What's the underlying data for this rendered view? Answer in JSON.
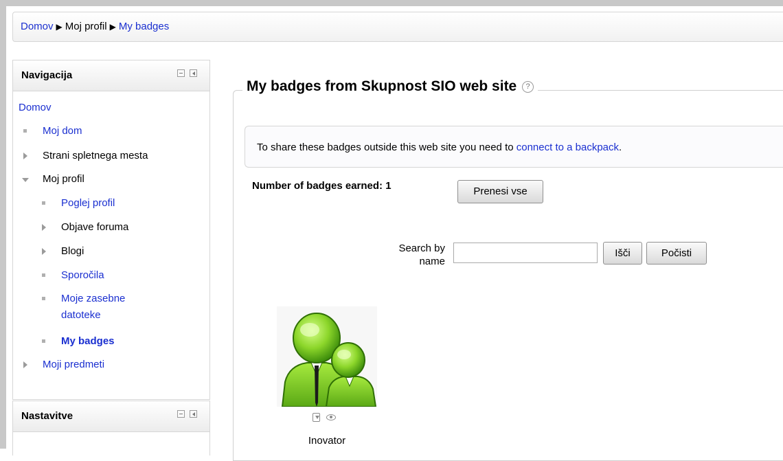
{
  "breadcrumb": {
    "items": [
      "Domov",
      "Moj profil",
      "My badges"
    ],
    "separator": "▶"
  },
  "navigation_block": {
    "title": "Navigacija",
    "items": [
      {
        "label": "Domov",
        "type": "link"
      },
      {
        "label": "Moj dom",
        "type": "link"
      },
      {
        "label": "Strani spletnega mesta",
        "type": "collapsed"
      },
      {
        "label": "Moj profil",
        "type": "expanded"
      },
      {
        "label": "Poglej profil",
        "type": "link"
      },
      {
        "label": "Objave foruma",
        "type": "collapsed"
      },
      {
        "label": "Blogi",
        "type": "collapsed"
      },
      {
        "label": "Sporočila",
        "type": "link"
      },
      {
        "label": "Moje zasebne",
        "type": "link"
      },
      {
        "label": "datoteke",
        "type": "link"
      },
      {
        "label": "My badges",
        "type": "current"
      },
      {
        "label": "Moji predmeti",
        "type": "collapsed"
      }
    ]
  },
  "settings_block": {
    "title": "Nastavitve"
  },
  "main": {
    "heading": "My badges from Skupnost SIO web site",
    "help_icon": "?",
    "notice_prefix": "To share these badges outside this web site you need to ",
    "notice_link": "connect to a backpack",
    "notice_suffix": ".",
    "badge_count_text": "Number of badges earned: 1",
    "download_all_label": "Prenesi vse",
    "search_label_line1": "Search by",
    "search_label_line2": "name",
    "search_value": "",
    "search_button_label": "Išči",
    "clear_button_label": "Počisti"
  },
  "badges": [
    {
      "name": "Inovator",
      "icon": "two-people-green-icon",
      "actions": [
        "download-icon",
        "view-icon"
      ]
    }
  ],
  "colors": {
    "link": "#1a2fd0",
    "badge_green": "#8cd62a"
  }
}
